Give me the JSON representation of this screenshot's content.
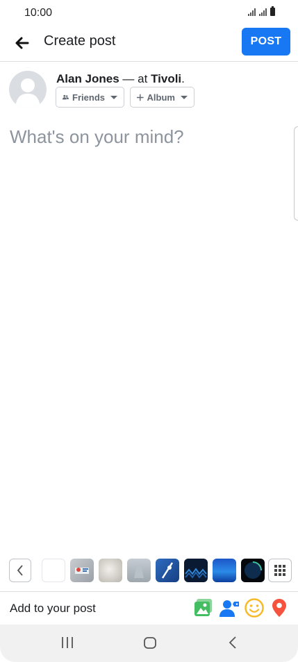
{
  "status": {
    "time": "10:00"
  },
  "header": {
    "title": "Create post",
    "post_label": "POST"
  },
  "author": {
    "name": "Alan Jones",
    "separator": " — at ",
    "place": "Tivoli",
    "suffix": "."
  },
  "chips": {
    "audience": "Friends",
    "album": "Album"
  },
  "composer": {
    "placeholder": "What's on your mind?"
  },
  "add_bar": {
    "label": "Add to your post"
  },
  "colors": {
    "accent": "#1877f2",
    "photo_green": "#45bd62",
    "tag_blue": "#1877f2",
    "feeling_yellow": "#f7b928",
    "location_red": "#f5533d"
  },
  "icons": [
    "back-arrow-icon",
    "friends-icon",
    "plus-icon",
    "chevron-left-icon",
    "grid-icon",
    "photo-icon",
    "tag-people-icon",
    "feeling-icon",
    "location-pin-icon",
    "recent-apps-icon",
    "home-icon",
    "back-nav-icon"
  ]
}
